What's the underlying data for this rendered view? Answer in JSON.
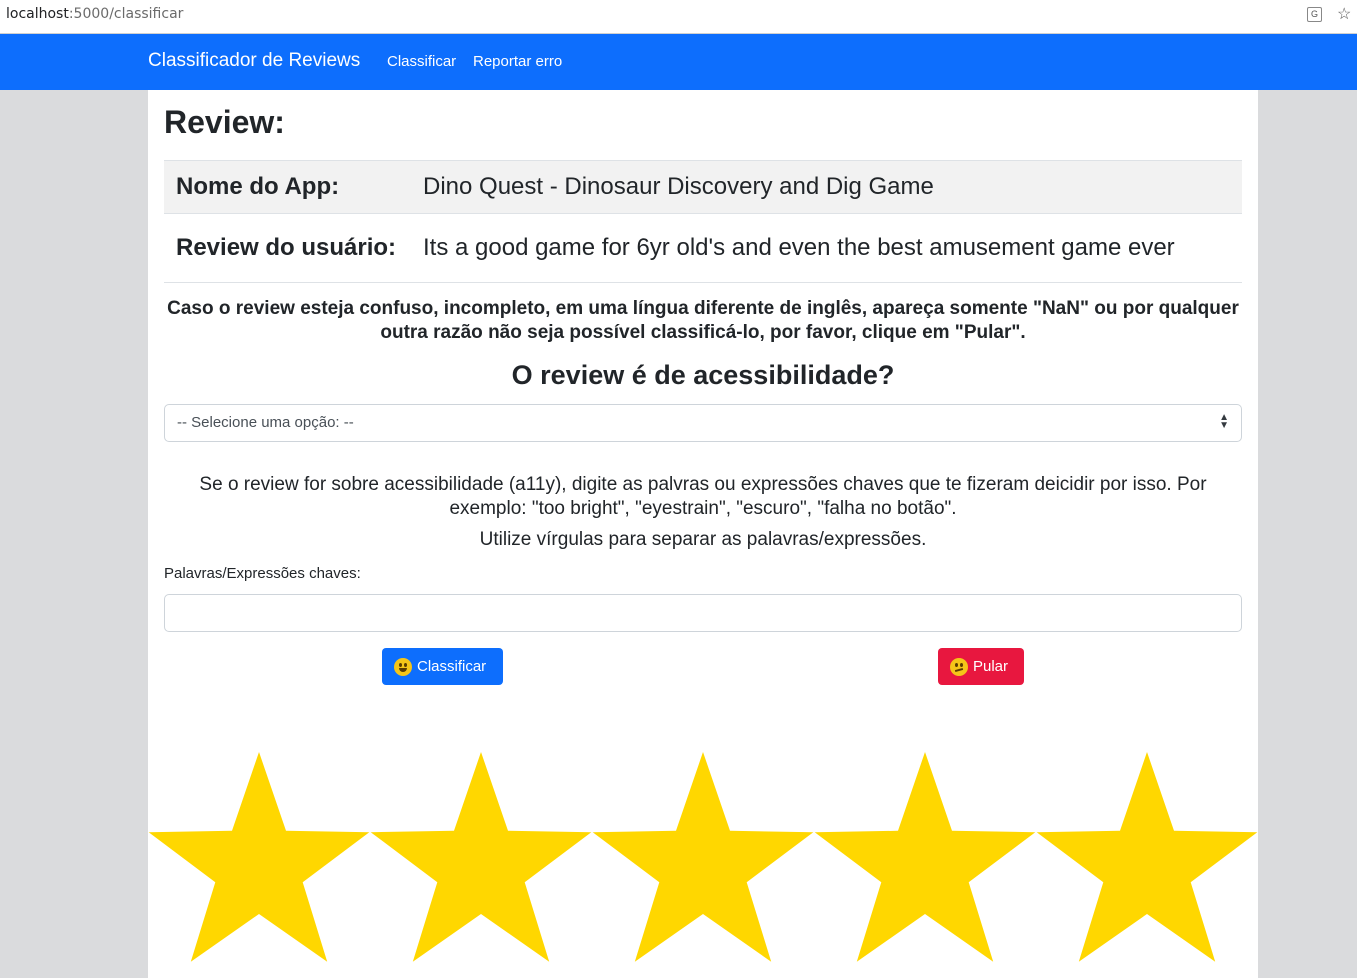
{
  "browser": {
    "url_host": "localhost",
    "url_path": ":5000/classificar"
  },
  "navbar": {
    "brand": "Classificador de Reviews",
    "links": [
      "Classificar",
      "Reportar erro"
    ],
    "color": "#0d6efd"
  },
  "main": {
    "heading": "Review:",
    "table": [
      {
        "key": "Nome do App:",
        "value": "Dino Quest - Dinosaur Discovery and Dig Game"
      },
      {
        "key": "Review do usuário:",
        "value": "Its a good game for 6yr old's and even the best amusement game ever"
      }
    ],
    "notice": "Caso o review esteja confuso, incompleto, em uma língua diferente de inglês, apareça somente \"NaN\" ou por qualquer outra razão não seja possível classificá-lo, por favor, clique em \"Pular\".",
    "question": "O review é de acessibilidade?",
    "select": {
      "selected": "-- Selecione uma opção: --"
    },
    "help_text": "Se o review for sobre acessibilidade (a11y), digite as palvras ou expressões chaves que te fizeram deicidir por isso. Por exemplo: \"too bright\", \"eyestrain\", \"escuro\", \"falha no botão\".",
    "help_text_2": "Utilize vírgulas para separar as palavras/expressões.",
    "keywords_label": "Palavras/Expressões chaves:",
    "keywords_value": "",
    "classify_button": "Classificar",
    "skip_button": "Pular",
    "classify_icon": "smiling-emoji-icon",
    "skip_icon": "confused-emoji-icon",
    "rating_stars": 5,
    "star_color": "#ffd700"
  }
}
